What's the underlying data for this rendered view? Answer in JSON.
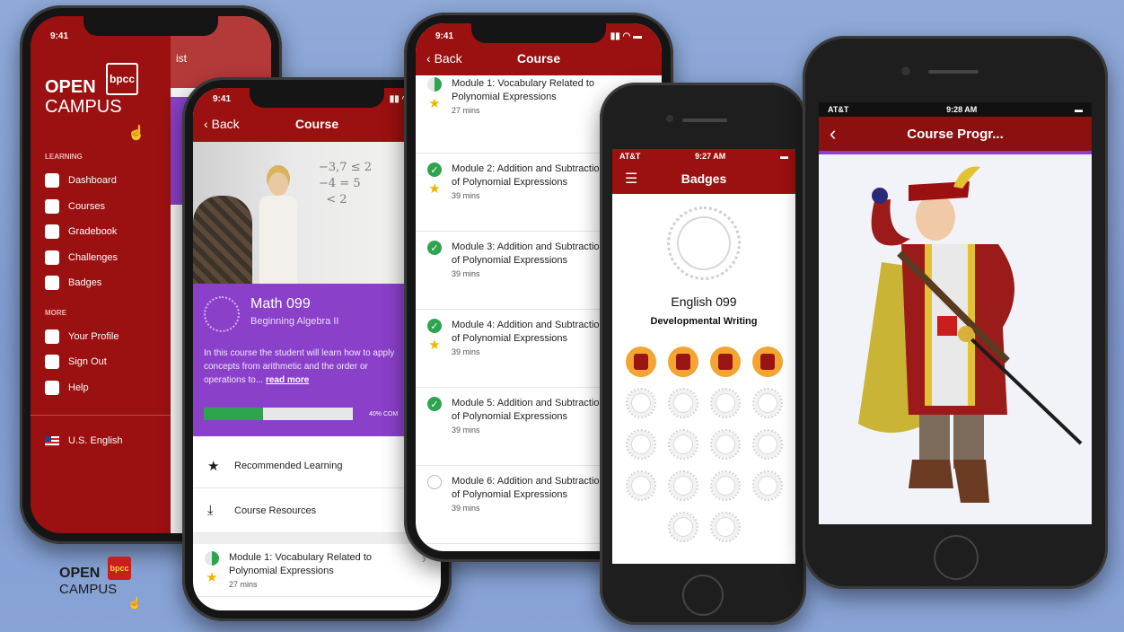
{
  "colors": {
    "maroon": "#9b1010",
    "purple": "#8a40c9",
    "green": "#2ea44f",
    "star": "#f0b400",
    "badge_orange": "#f3a431"
  },
  "logo": {
    "open": "OPEN",
    "campus": "CAMPUS",
    "mark": "bpcc"
  },
  "phone1": {
    "time": "9:41",
    "behind_text": "ist",
    "section_learning": "LEARNING",
    "learning_items": [
      {
        "label": "Dashboard",
        "icon": "dashboard-icon"
      },
      {
        "label": "Courses",
        "icon": "courses-icon"
      },
      {
        "label": "Gradebook",
        "icon": "gradebook-icon"
      },
      {
        "label": "Challenges",
        "icon": "challenges-icon"
      },
      {
        "label": "Badges",
        "icon": "badges-icon"
      }
    ],
    "section_more": "MORE",
    "more_items": [
      {
        "label": "Your Profile",
        "icon": "profile-icon"
      },
      {
        "label": "Sign Out",
        "icon": "lock-icon"
      },
      {
        "label": "Help",
        "icon": "help-icon"
      }
    ],
    "language": "U.S. English"
  },
  "phone2": {
    "time": "9:41",
    "back": "Back",
    "title": "Course",
    "course_name": "Math 099",
    "course_subtitle": "Beginning Algebra II",
    "description": "In this course the student will learn how to apply concepts from arithmetic and the order or operations to...",
    "read_more": "read more",
    "progress": 0.4,
    "progress_label": "40% COM",
    "menu_items": [
      {
        "label": "Recommended Learning",
        "icon": "star-icon"
      },
      {
        "label": "Course Resources",
        "icon": "download-icon"
      }
    ],
    "module": {
      "title": "Module 1: Vocabulary Related to Polynomial Expressions",
      "mins": "27 mins"
    }
  },
  "phone3": {
    "time": "9:41",
    "back": "Back",
    "title": "Course",
    "modules": [
      {
        "title": "Module 1: Vocabulary Related to Polynomial Expressions",
        "mins": "27 mins",
        "status": "partial",
        "star": true
      },
      {
        "title": "Module 2: Addition and Subtraction of Polynomial Expressions",
        "mins": "39 mins",
        "status": "done",
        "star": true
      },
      {
        "title": "Module 3: Addition and Subtraction of Polynomial Expressions",
        "mins": "39 mins",
        "status": "done",
        "star": false
      },
      {
        "title": "Module 4: Addition and Subtraction of Polynomial Expressions",
        "mins": "39 mins",
        "status": "done",
        "star": true
      },
      {
        "title": "Module 5: Addition and Subtraction of Polynomial Expressions",
        "mins": "39 mins",
        "status": "done",
        "star": false
      },
      {
        "title": "Module 6: Addition and Subtraction of Polynomial Expressions",
        "mins": "39 mins",
        "status": "none",
        "star": false
      }
    ]
  },
  "phone4": {
    "carrier": "AT&T",
    "time": "9:27 AM",
    "title": "Badges",
    "course_name": "English 099",
    "course_subtitle": "Developmental Writing",
    "earned_badges": 4,
    "total_badges": 18
  },
  "phone5": {
    "carrier": "AT&T",
    "time": "9:28 AM",
    "title": "Course Progr..."
  }
}
